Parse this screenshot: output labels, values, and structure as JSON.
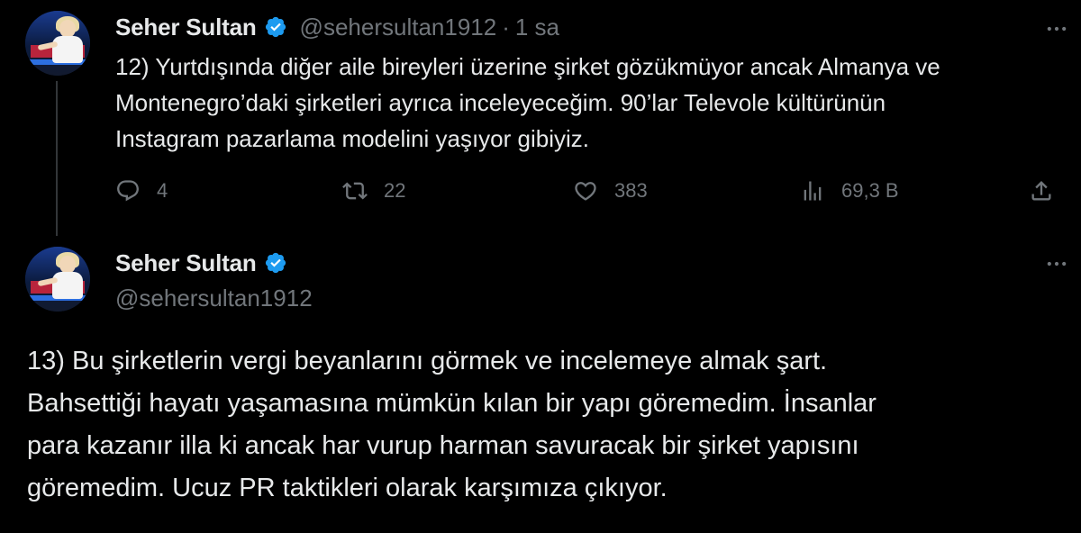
{
  "tweets": [
    {
      "author": {
        "name": "Seher Sultan",
        "handle": "@sehersultan1912",
        "verified": true
      },
      "time": "1 sa",
      "separator": "·",
      "text": "12) Yurtdışında diğer aile bireyleri üzerine şirket gözükmüyor ancak Almanya ve\nMontenegro’daki şirketleri ayrıca inceleyeceğim. 90’lar Televole kültürünün\nInstagram pazarlama modelini yaşıyor gibiyiz.",
      "actions": {
        "replies": "4",
        "retweets": "22",
        "likes": "383",
        "views": "69,3 B"
      }
    },
    {
      "author": {
        "name": "Seher Sultan",
        "handle": "@sehersultan1912",
        "verified": true
      },
      "text": "13) Bu şirketlerin vergi beyanlarını görmek ve incelemeye almak şart.\nBahsettiği hayatı yaşamasına mümkün kılan bir yapı göremedim. İnsanlar\npara kazanır illa ki ancak har vurup harman savuracak bir şirket yapısını\ngöremedim. Ucuz PR taktikleri olarak karşımıza çıkıyor."
    }
  ],
  "icons": {
    "verified": "verified-badge-icon",
    "more": "more-horizontal-icon",
    "reply": "reply-icon",
    "retweet": "retweet-icon",
    "like": "heart-icon",
    "views": "views-icon",
    "share": "share-icon"
  },
  "colors": {
    "background": "#000000",
    "text_primary": "#e7e9ea",
    "text_secondary": "#71767b",
    "verified_blue": "#1d9bf0",
    "thread_line": "#333639"
  }
}
